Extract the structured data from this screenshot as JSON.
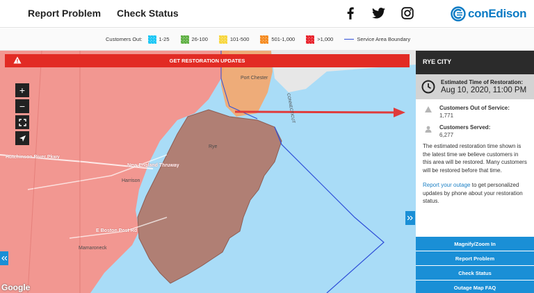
{
  "nav": {
    "report_problem": "Report Problem",
    "check_status": "Check Status",
    "brand": "conEdison"
  },
  "social_icons": [
    "facebook-icon",
    "twitter-icon",
    "instagram-icon"
  ],
  "legend": {
    "label": "Customers Out:",
    "items": [
      "1-25",
      "26-100",
      "101-500",
      "501-1,000",
      ">1,000"
    ],
    "colors": [
      "#19c6f5",
      "#5fb043",
      "#f7d63d",
      "#f58a1f",
      "#e8212a"
    ],
    "boundary": "Service Area Boundary"
  },
  "map": {
    "alert": "GET RESTORATION UPDATES",
    "controls": [
      "+",
      "−"
    ],
    "labels": {
      "port_chester": "Port Chester",
      "rye": "Rye",
      "harrison": "Harrison",
      "mamaroneck": "Mamaroneck",
      "new_england": "New England Thruway",
      "hutchinson": "Hutchinson River Pkwy",
      "boston_post": "E Boston Post Rd",
      "connecticut": "CONNECTICUT"
    },
    "attribution": "Google"
  },
  "panel": {
    "title": "RYE CITY",
    "restore_label": "Estimated Time of Restoration:",
    "restore_value": "Aug 10, 2020, 11:00 PM",
    "out_label": "Customers Out of Service:",
    "out_value": "1,771",
    "served_label": "Customers Served:",
    "served_value": "6,277",
    "paragraph": "The estimated restoration time shown is the latest time we believe customers in this area will be restored. Many customers will be restored before that time.",
    "report_link": "Report your outage",
    "report_rest": " to get personalized updates by phone about your restoration status.",
    "buttons": {
      "magnify": "Magnify/Zoom In",
      "report": "Report Problem",
      "check": "Check Status",
      "faq": "Outage Map FAQ"
    }
  }
}
